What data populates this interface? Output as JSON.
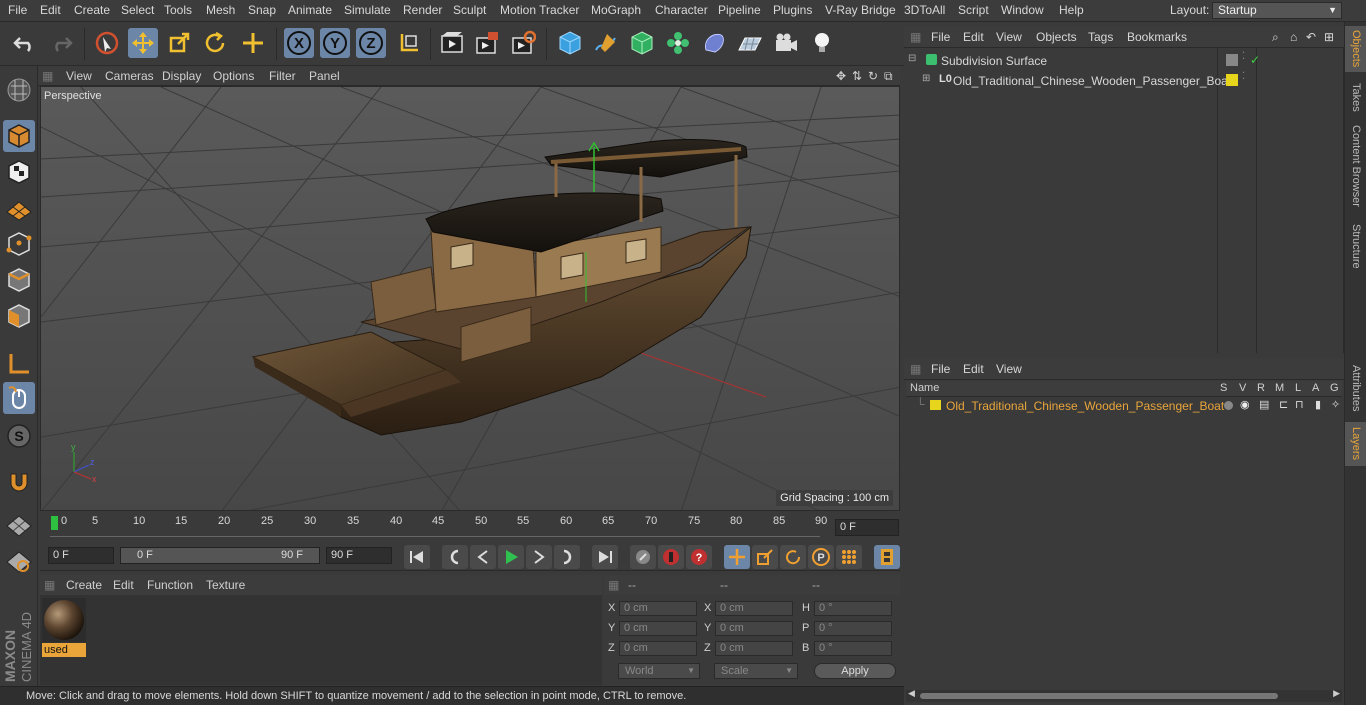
{
  "menubar": {
    "items": [
      "File",
      "Edit",
      "Create",
      "Select",
      "Tools",
      "Mesh",
      "Snap",
      "Animate",
      "Simulate",
      "Render",
      "Sculpt",
      "Motion Tracker",
      "MoGraph",
      "Character",
      "Pipeline",
      "Plugins",
      "V-Ray Bridge",
      "3DToAll",
      "Script",
      "Window",
      "Help"
    ],
    "layout_label": "Layout:",
    "layout_value": "Startup"
  },
  "toolbar": {
    "icons": [
      "undo-icon",
      "redo-icon",
      "live-selection-icon",
      "move-icon",
      "scale-icon",
      "rotate-icon",
      "last-tool-icon",
      "x-axis-icon",
      "y-axis-icon",
      "z-axis-icon",
      "world-coordinates-icon",
      "render-view-icon",
      "render-picture-viewer-icon",
      "edit-render-settings-icon",
      "cube-icon",
      "pen-icon",
      "subdivision-icon",
      "cloner-icon",
      "deformer-icon",
      "floor-icon",
      "camera-icon",
      "light-icon"
    ]
  },
  "viewport": {
    "menu": [
      "View",
      "Cameras",
      "Display",
      "Options",
      "Filter",
      "Panel"
    ],
    "label": "Perspective",
    "grid_spacing": "Grid Spacing : 100 cm"
  },
  "timeline": {
    "ticks": [
      "0",
      "5",
      "10",
      "15",
      "20",
      "25",
      "30",
      "35",
      "40",
      "45",
      "50",
      "55",
      "60",
      "65",
      "70",
      "75",
      "80",
      "85",
      "90"
    ],
    "current_frame": "0 F"
  },
  "transport": {
    "start_field": "0 F",
    "range_start": "0 F",
    "range_end": "90 F",
    "end_field": "90 F"
  },
  "materials": {
    "menu": [
      "Create",
      "Edit",
      "Function",
      "Texture"
    ],
    "items": [
      {
        "label": "used"
      }
    ]
  },
  "coordinates": {
    "headers": [
      "--",
      "--",
      "--"
    ],
    "rows": [
      {
        "l1": "X",
        "v1": "0 cm",
        "l2": "X",
        "v2": "0 cm",
        "l3": "H",
        "v3": "0 °"
      },
      {
        "l1": "Y",
        "v1": "0 cm",
        "l2": "Y",
        "v2": "0 cm",
        "l3": "P",
        "v3": "0 °"
      },
      {
        "l1": "Z",
        "v1": "0 cm",
        "l2": "Z",
        "v2": "0 cm",
        "l3": "B",
        "v3": "0 °"
      }
    ],
    "mode_select": "World",
    "scale_select": "Scale",
    "apply_label": "Apply"
  },
  "objects": {
    "menu": [
      "File",
      "Edit",
      "View",
      "Objects",
      "Tags",
      "Bookmarks"
    ],
    "items": [
      {
        "name": "Subdivision Surface"
      },
      {
        "name": "Old_Traditional_Chinese_Wooden_Passenger_Boat"
      }
    ]
  },
  "layers": {
    "menu": [
      "File",
      "Edit",
      "View"
    ],
    "header_name": "Name",
    "columns": [
      "S",
      "V",
      "R",
      "M",
      "L",
      "A",
      "G"
    ],
    "items": [
      {
        "name": "Old_Traditional_Chinese_Wooden_Passenger_Boat"
      }
    ]
  },
  "side_tabs": [
    "Objects",
    "Takes",
    "Content Browser",
    "Structure",
    "Attributes",
    "Layers"
  ],
  "status": "Move: Click and drag to move elements. Hold down SHIFT to quantize movement / add to the selection in point mode, CTRL to remove.",
  "logo": {
    "brand": "MAXON",
    "product": "CINEMA 4D"
  },
  "colors": {
    "highlight": "#6c86a8",
    "accent": "#e9a53a",
    "layer_yellow": "#e6d51c"
  }
}
